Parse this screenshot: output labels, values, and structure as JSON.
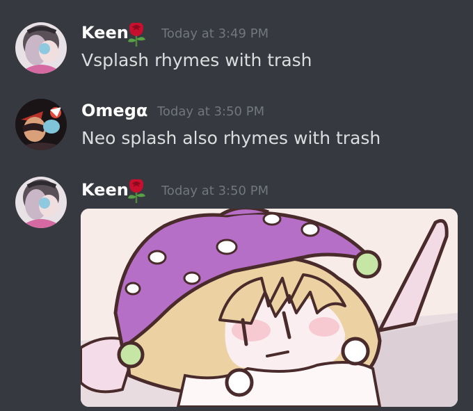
{
  "messages": [
    {
      "author": "Keen",
      "author_emoji": "rose-emoji",
      "timestamp": "Today at 3:49 PM",
      "text": "Vsplash rhymes with trash"
    },
    {
      "author": "Omegα",
      "timestamp": "Today at 3:50 PM",
      "text": "Neo splash also rhymes with trash"
    },
    {
      "author": "Keen",
      "author_emoji": "rose-emoji",
      "timestamp": "Today at 3:50 PM",
      "attachment": "jester-hat-character-image"
    }
  ],
  "colors": {
    "background": "#36393f",
    "author_name": "#ffffff",
    "message_text": "#dcddde",
    "timestamp": "#72767d"
  }
}
